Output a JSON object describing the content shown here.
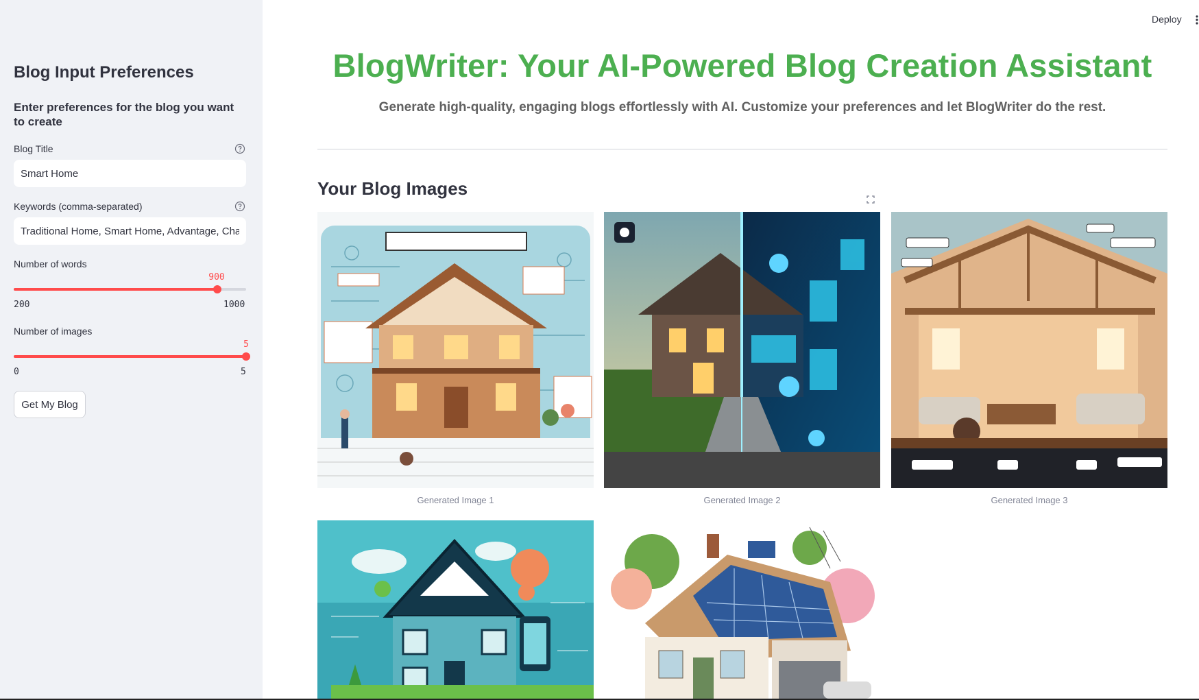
{
  "topbar": {
    "deploy_label": "Deploy",
    "menu_icon": "more-vertical-icon"
  },
  "sidebar": {
    "title": "Blog Input Preferences",
    "subtitle": "Enter preferences for the blog you want to create",
    "blog_title": {
      "label": "Blog Title",
      "value": "Smart Home",
      "help_icon": "help-circle-icon"
    },
    "keywords": {
      "label": "Keywords (comma-separated)",
      "value": "Traditional Home, Smart Home, Advantage, Chal",
      "help_icon": "help-circle-icon"
    },
    "words_slider": {
      "label": "Number of words",
      "value": "900",
      "min": "200",
      "max": "1000",
      "fraction": 0.875
    },
    "images_slider": {
      "label": "Number of images",
      "value": "5",
      "min": "0",
      "max": "5",
      "fraction": 1.0
    },
    "submit_label": "Get My Blog"
  },
  "main": {
    "title": "BlogWriter: Your AI-Powered Blog Creation Assistant",
    "subtitle": "Generate high-quality, engaging blogs effortlessly with AI. Customize your preferences and let BlogWriter do the rest.",
    "section_heading": "Your Blog Images",
    "images": [
      {
        "caption": "Generated Image 1"
      },
      {
        "caption": "Generated Image 2"
      },
      {
        "caption": "Generated Image 3"
      },
      {
        "caption": ""
      },
      {
        "caption": ""
      }
    ]
  },
  "colors": {
    "accent": "#ff4b4b",
    "title_green": "#4caf50",
    "sidebar_bg": "#f0f2f6"
  }
}
